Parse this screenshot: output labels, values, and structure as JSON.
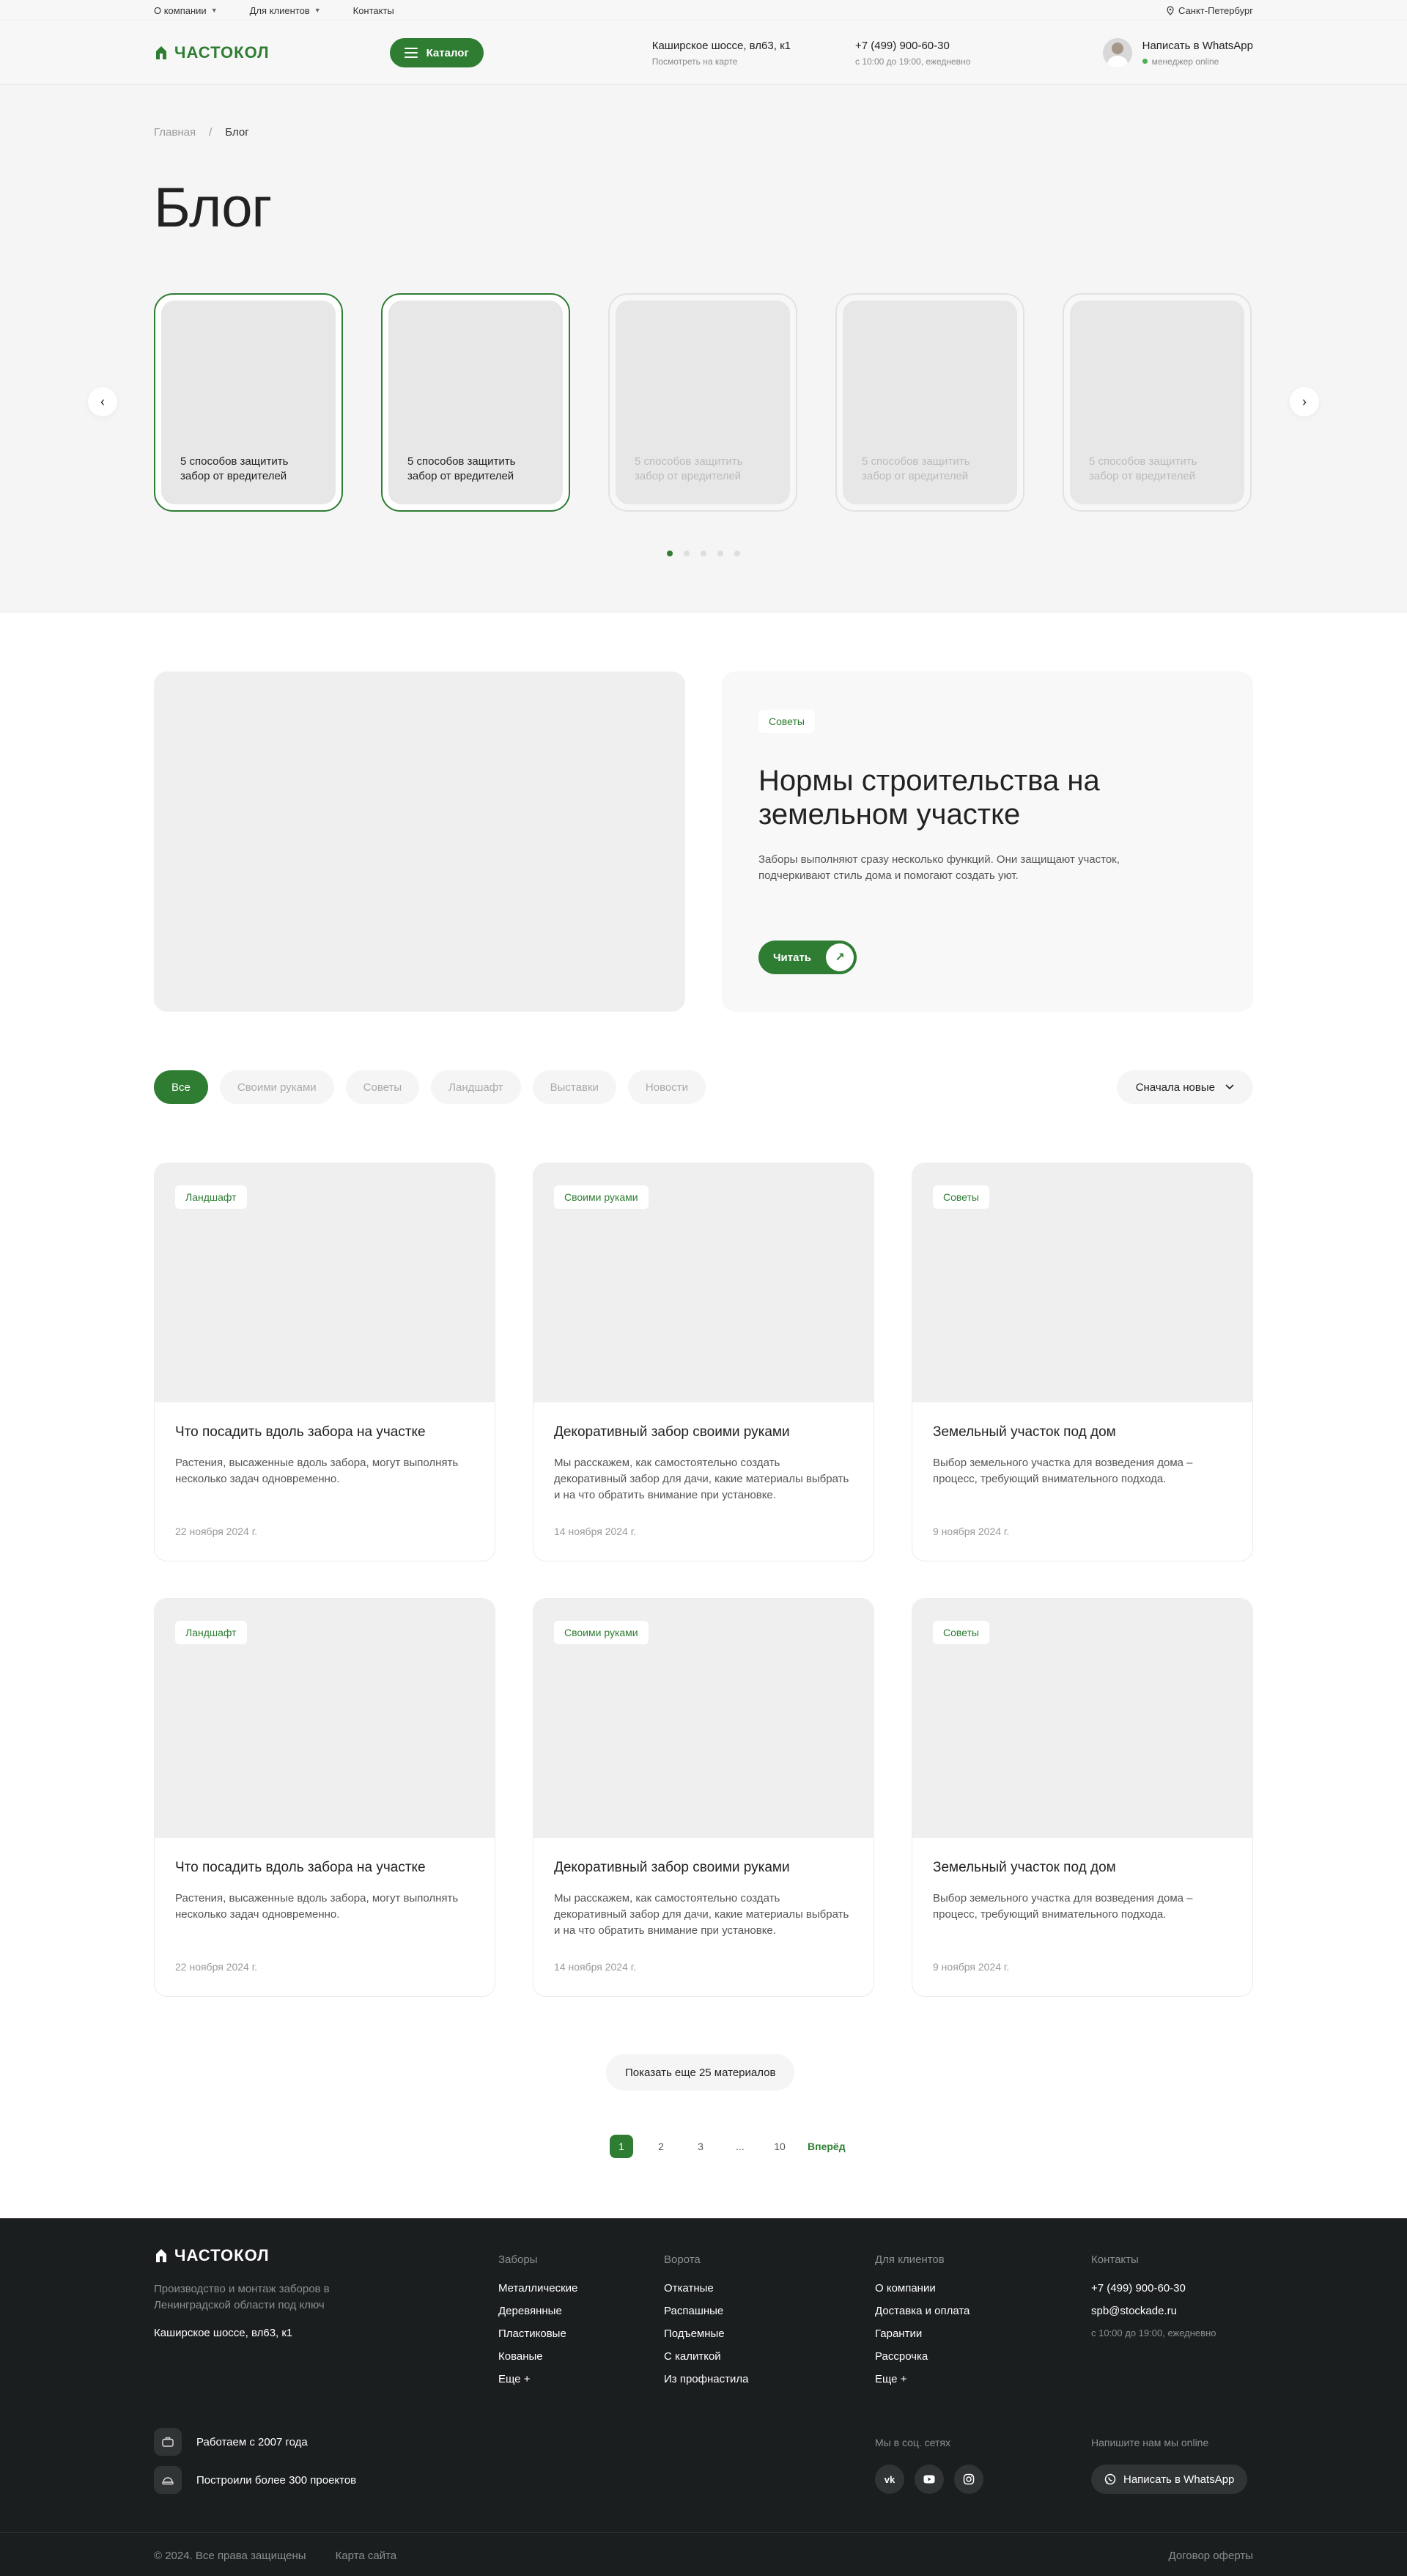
{
  "topbar": {
    "links": [
      "О компании",
      "Для клиентов",
      "Контакты"
    ],
    "city": "Санкт-Петербург"
  },
  "header": {
    "logo": "ЧАСТОКОЛ",
    "catalog": "Каталог",
    "address": "Каширское шоссе, вл63, к1",
    "address_sub": "Посмотреть на карте",
    "phone": "+7 (499) 900-60-30",
    "phone_sub": "с 10:00 до 19:00, ежедневно",
    "whatsapp": "Написать в WhatsApp",
    "manager": "менеджер online"
  },
  "breadcrumbs": {
    "home": "Главная",
    "sep": "/",
    "current": "Блог"
  },
  "page_title": "Блог",
  "stories": [
    {
      "caption": "5 способов защитить забор от вредителей",
      "active": true
    },
    {
      "caption": "5 способов защитить забор от вредителей",
      "active": true
    },
    {
      "caption": "5 способов защитить забор от вредителей",
      "active": false
    },
    {
      "caption": "5 способов защитить забор от вредителей",
      "active": false
    },
    {
      "caption": "5 способов защитить забор от вредителей",
      "active": false
    }
  ],
  "carousel_pages": 5,
  "carousel_active_page": 1,
  "featured": {
    "tag": "Советы",
    "title": "Нормы строительства на земельном участке",
    "text": "Заборы выполняют сразу несколько функций. Они защищают участок, подчеркивают стиль дома и помогают создать уют.",
    "button": "Читать"
  },
  "filters": {
    "items": [
      "Все",
      "Своими руками",
      "Советы",
      "Ландшафт",
      "Выставки",
      "Новости"
    ],
    "active": "Все",
    "sort": "Сначала новые"
  },
  "articles": [
    {
      "tag": "Ландшафт",
      "title": "Что посадить вдоль забора на участке",
      "text": "Растения, высаженные вдоль забора, могут выполнять несколько задач одновременно.",
      "date": "22 ноября 2024 г."
    },
    {
      "tag": "Своими руками",
      "title": "Декоративный забор своими руками",
      "text": "Мы расскажем, как самостоятельно создать декоративный забор для дачи, какие материалы выбрать и на что обратить внимание при установке.",
      "date": "14 ноября 2024 г."
    },
    {
      "tag": "Советы",
      "title": "Земельный участок под дом",
      "text": "Выбор земельного участка для возведения дома – процесс, требующий внимательного подхода.",
      "date": "9 ноября 2024 г."
    },
    {
      "tag": "Ландшафт",
      "title": "Что посадить вдоль забора на участке",
      "text": "Растения, высаженные вдоль забора, могут выполнять несколько задач одновременно.",
      "date": "22 ноября 2024 г."
    },
    {
      "tag": "Своими руками",
      "title": "Декоративный забор своими руками",
      "text": "Мы расскажем, как самостоятельно создать декоративный забор для дачи, какие материалы выбрать и на что обратить внимание при установке.",
      "date": "14 ноября 2024 г."
    },
    {
      "tag": "Советы",
      "title": "Земельный участок под дом",
      "text": "Выбор земельного участка для возведения дома – процесс, требующий внимательного подхода.",
      "date": "9 ноября 2024 г."
    }
  ],
  "show_more": "Показать еще 25 материалов",
  "pagination": {
    "pages": [
      "1",
      "2",
      "3",
      "...",
      "10"
    ],
    "active": "1",
    "next": "Вперёд"
  },
  "footer": {
    "logo": "ЧАСТОКОЛ",
    "description": "Производство и монтаж заборов в Ленинградской области под ключ",
    "address": "Каширское шоссе, вл63, к1",
    "col_fences": {
      "title": "Заборы",
      "items": [
        "Металлические",
        "Деревянные",
        "Пластиковые",
        "Кованые",
        "Еще +"
      ]
    },
    "col_gates": {
      "title": "Ворота",
      "items": [
        "Откатные",
        "Распашные",
        "Подъемные",
        "С калиткой",
        "Из профнастила"
      ]
    },
    "col_clients": {
      "title": "Для клиентов",
      "items": [
        "О компании",
        "Доставка и оплата",
        "Гарантии",
        "Рассрочка",
        "Еще +"
      ]
    },
    "contacts": {
      "title": "Контакты",
      "phone": "+7 (499) 900-60-30",
      "email": "spb@stockade.ru",
      "hours": "с 10:00 до 19:00, ежедневно"
    },
    "stats": [
      "Работаем с 2007 года",
      "Построили более 300 проектов"
    ],
    "social_title": "Мы в соц. сетях",
    "socials": [
      "vk-icon",
      "youtube-icon",
      "instagram-icon"
    ],
    "whatsapp_title": "Напишите нам мы online",
    "whatsapp_btn": "Написать в WhatsApp",
    "copyright": "© 2024. Все права защищены",
    "sitemap": "Карта сайта",
    "offer": "Договор оферты"
  },
  "colors": {
    "accent": "#2e7d32",
    "footer_bg": "#1b1e1f",
    "hero_bg": "#f5f5f5"
  }
}
